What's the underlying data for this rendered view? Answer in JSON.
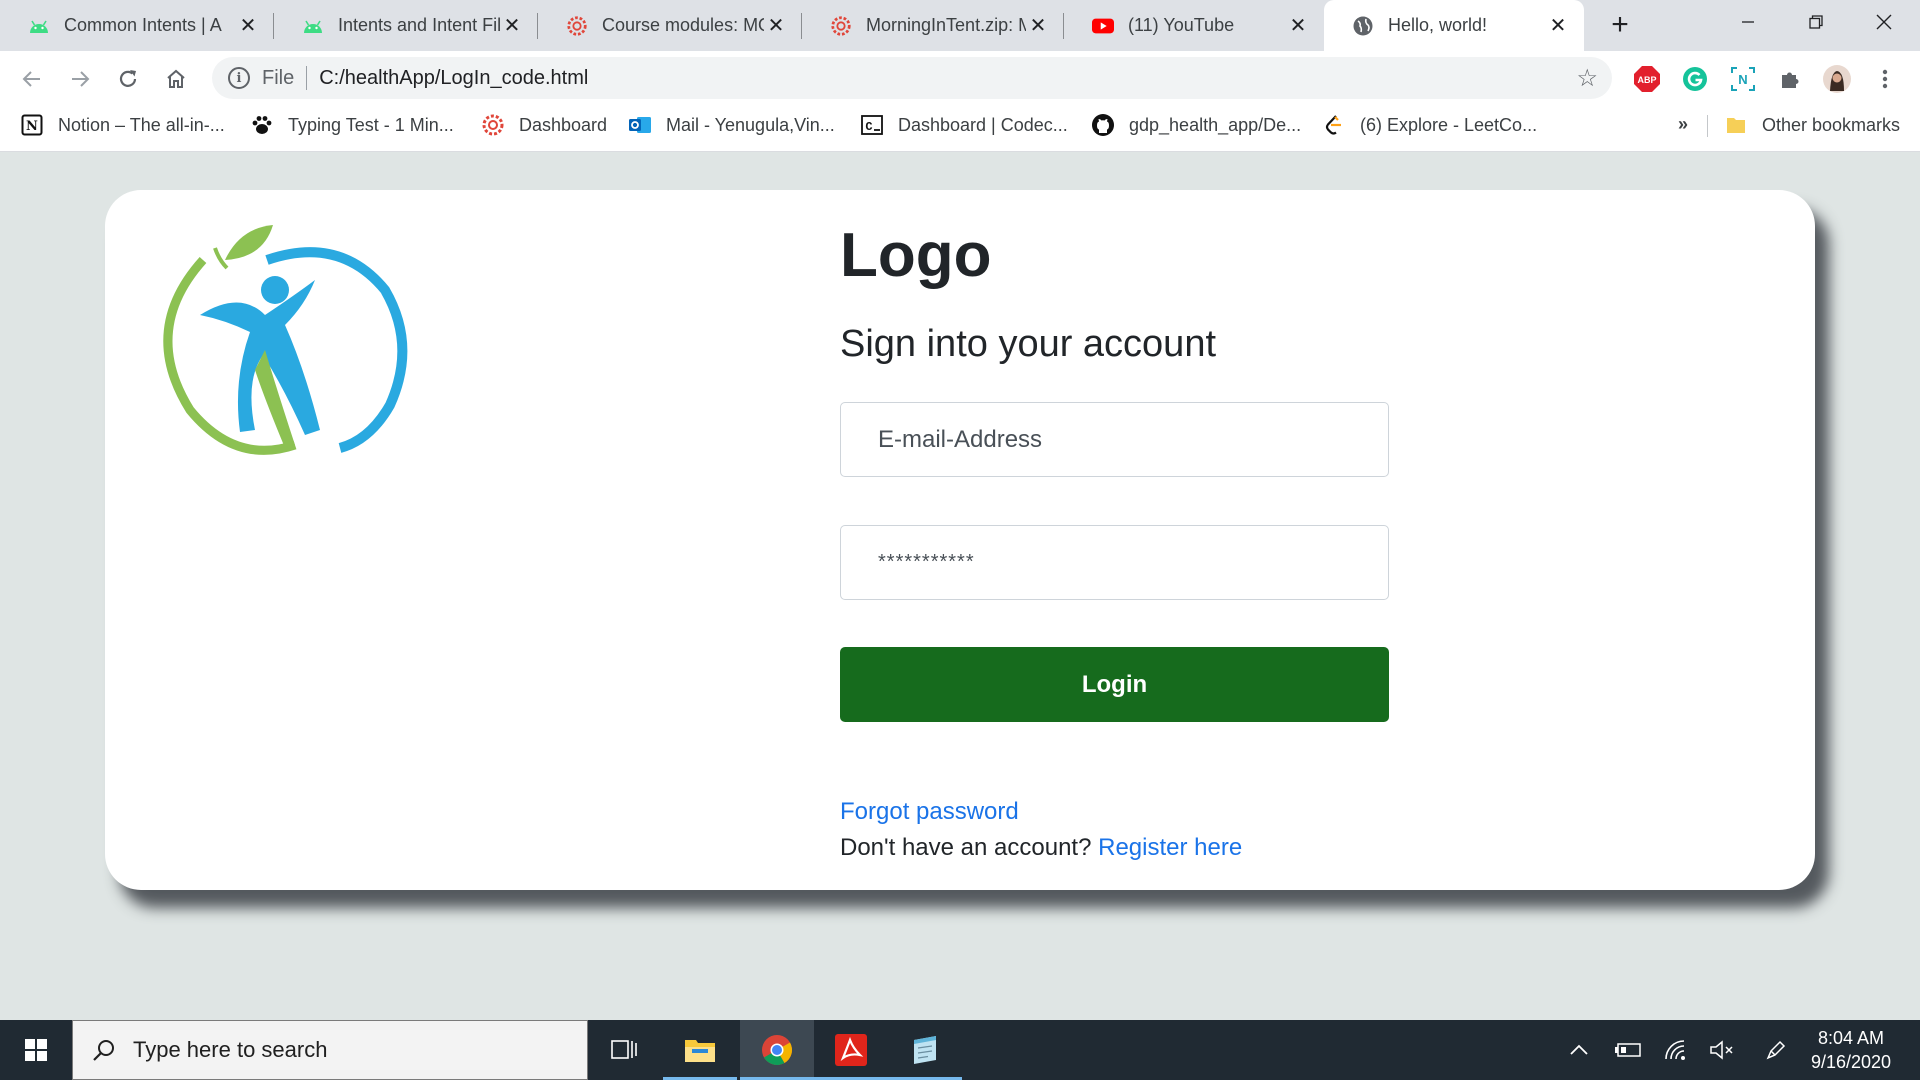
{
  "browser": {
    "tabs": [
      {
        "title": "Common Intents | A",
        "icon": "android-icon"
      },
      {
        "title": "Intents and Intent Fil",
        "icon": "android-icon"
      },
      {
        "title": "Course modules: MO",
        "icon": "red-gear-icon"
      },
      {
        "title": "MorningInTent.zip: M",
        "icon": "red-gear-icon"
      },
      {
        "title": "(11) YouTube",
        "icon": "youtube-icon"
      },
      {
        "title": "Hello, world!",
        "icon": "globe-icon"
      }
    ],
    "address": {
      "scheme_label": "File",
      "url": "C:/healthApp/LogIn_code.html"
    },
    "extensions": [
      "adblock-plus-icon",
      "grammarly-icon",
      "notion-clipper-icon",
      "extensions-puzzle-icon",
      "profile-avatar",
      "chrome-menu-icon"
    ],
    "bookmarks": [
      {
        "label": "Notion – The all-in-...",
        "icon": "notion-icon"
      },
      {
        "label": "Typing Test - 1 Min...",
        "icon": "paw-icon"
      },
      {
        "label": "Dashboard",
        "icon": "red-gear-icon"
      },
      {
        "label": "Mail - Yenugula,Vin...",
        "icon": "outlook-icon"
      },
      {
        "label": "Dashboard | Codec...",
        "icon": "codecademy-icon"
      },
      {
        "label": "gdp_health_app/De...",
        "icon": "github-icon"
      },
      {
        "label": "(6) Explore - LeetCo...",
        "icon": "leetcode-icon"
      }
    ],
    "bookmarks_overflow": "»",
    "other_bookmarks": "Other bookmarks"
  },
  "login": {
    "heading": "Logo",
    "subheading": "Sign into your account",
    "email_placeholder": "E-mail-Address",
    "password_value": "***********",
    "login_button": "Login",
    "forgot_password": "Forgot password",
    "no_account_text": "Don't have an account?",
    "register_link": "Register here"
  },
  "taskbar": {
    "search_placeholder": "Type here to search",
    "time": "8:04 AM",
    "date": "9/16/2020"
  },
  "colors": {
    "login_button": "#166b1d",
    "link": "#1a73e8",
    "page_background": "#dfe5e4",
    "taskbar": "#202a33"
  }
}
